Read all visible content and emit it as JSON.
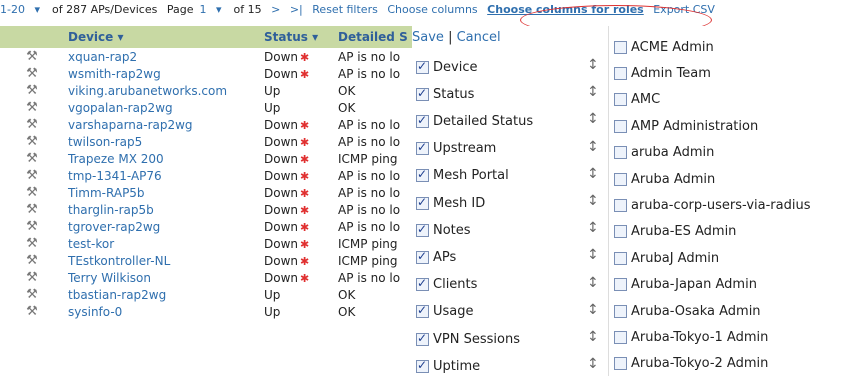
{
  "pager": {
    "range": "1-20",
    "total": "of 287 APs/Devices",
    "page_label": "Page",
    "page": "1",
    "of_pages": "of 15",
    "next": ">",
    "last": ">|",
    "reset_filters": "Reset filters",
    "choose_columns": "Choose columns",
    "choose_columns_roles": "Choose columns for roles",
    "export_csv": "Export CSV"
  },
  "table": {
    "headers": {
      "device": "Device",
      "status": "Status",
      "detailed": "Detailed S"
    },
    "rows": [
      {
        "device": "xquan-rap2",
        "status": "Down",
        "detail": "AP is no lo"
      },
      {
        "device": "wsmith-rap2wg",
        "status": "Down",
        "detail": "AP is no lo"
      },
      {
        "device": "viking.arubanetworks.com",
        "status": "Up",
        "detail": "OK"
      },
      {
        "device": "vgopalan-rap2wg",
        "status": "Up",
        "detail": "OK"
      },
      {
        "device": "varshaparna-rap2wg",
        "status": "Down",
        "detail": "AP is no lo"
      },
      {
        "device": "twilson-rap5",
        "status": "Down",
        "detail": "AP is no lo"
      },
      {
        "device": "Trapeze MX 200",
        "status": "Down",
        "detail": "ICMP ping"
      },
      {
        "device": "tmp-1341-AP76",
        "status": "Down",
        "detail": "AP is no lo"
      },
      {
        "device": "Timm-RAP5b",
        "status": "Down",
        "detail": "AP is no lo"
      },
      {
        "device": "tharglin-rap5b",
        "status": "Down",
        "detail": "AP is no lo"
      },
      {
        "device": "tgrover-rap2wg",
        "status": "Down",
        "detail": "AP is no lo"
      },
      {
        "device": "test-kor",
        "status": "Down",
        "detail": "ICMP ping"
      },
      {
        "device": "TEstkontroller-NL",
        "status": "Down",
        "detail": "ICMP ping"
      },
      {
        "device": "Terry Wilkison",
        "status": "Down",
        "detail": "AP is no lo"
      },
      {
        "device": "tbastian-rap2wg",
        "status": "Up",
        "detail": "OK"
      },
      {
        "device": "sysinfo-0",
        "status": "Up",
        "detail": "OK"
      }
    ]
  },
  "chooser": {
    "save": "Save",
    "divider": "|",
    "cancel": "Cancel",
    "columns": [
      {
        "label": "Device",
        "checked": true
      },
      {
        "label": "Status",
        "checked": true
      },
      {
        "label": "Detailed Status",
        "checked": true
      },
      {
        "label": "Upstream",
        "checked": true
      },
      {
        "label": "Mesh Portal",
        "checked": true
      },
      {
        "label": "Mesh ID",
        "checked": true
      },
      {
        "label": "Notes",
        "checked": true
      },
      {
        "label": "APs",
        "checked": true
      },
      {
        "label": "Clients",
        "checked": true
      },
      {
        "label": "Usage",
        "checked": true
      },
      {
        "label": "VPN Sessions",
        "checked": true
      },
      {
        "label": "Uptime",
        "checked": true
      }
    ],
    "roles": [
      "ACME Admin",
      "Admin Team",
      "AMC",
      "AMP Administration",
      "aruba Admin",
      "Aruba Admin",
      "aruba-corp-users-via-radius",
      "Aruba-ES Admin",
      "ArubaJ Admin",
      "Aruba-Japan Admin",
      "Aruba-Osaka Admin",
      "Aruba-Tokyo-1 Admin",
      "Aruba-Tokyo-2 Admin"
    ]
  },
  "colors": {
    "header_bg": "#c8d9a3",
    "link": "#2f6fae",
    "down_arrow": "#e03030",
    "highlight_oval": "#d33"
  }
}
